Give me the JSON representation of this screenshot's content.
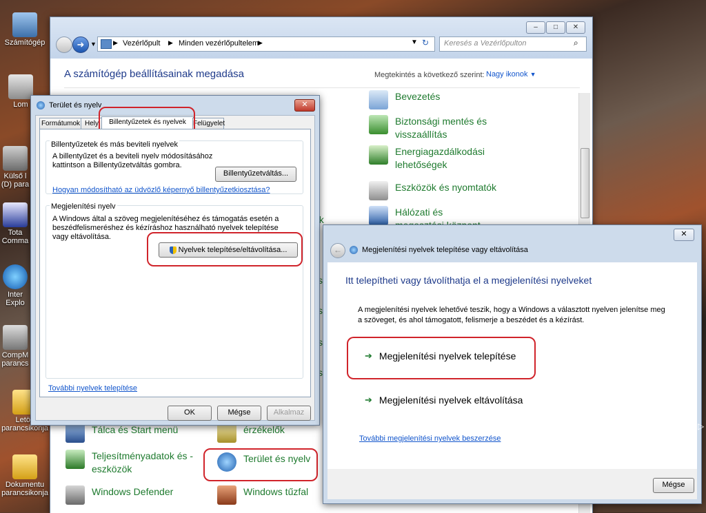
{
  "desktop": {
    "icons": [
      {
        "label": "Számítógép"
      },
      {
        "label": "Lom"
      },
      {
        "label": "Külső l (D) para"
      },
      {
        "label": "Tota Comma"
      },
      {
        "label": "Inter Explo"
      },
      {
        "label": "CompM parancs"
      },
      {
        "label": "Letölt parancsikonja"
      },
      {
        "label": "Dokumentu parancsikonja"
      }
    ]
  },
  "control_panel": {
    "address": {
      "breadcrumb1": "Vezérlőpult",
      "breadcrumb2": "Minden vezérlőpultelem",
      "search_placeholder": "Keresés a Vezérlőpulton"
    },
    "heading": "A számítógép beállításainak megadása",
    "view_label": "Megtekintés a következő szerint:",
    "view_value": "Nagy ikonok",
    "items_right": [
      {
        "label": "Bevezetés"
      },
      {
        "label": "Biztonsági mentés és visszaállítás"
      },
      {
        "label": "Energiagazdálkodási lehetőségek"
      },
      {
        "label": "Eszközök és nyomtatók"
      },
      {
        "label": "Hálózati és megosztási központ"
      }
    ],
    "items_bottom": [
      {
        "label": "Tálca és Start menü"
      },
      {
        "label": "érzékelők"
      },
      {
        "label": "Teljesítményadatok és -eszközök"
      },
      {
        "label": "Terület és nyelv"
      },
      {
        "label": "Windows Defender"
      },
      {
        "label": "Windows tűzfal"
      }
    ],
    "partial_left": [
      "ök",
      "s",
      "s",
      "s",
      "s"
    ]
  },
  "region_dialog": {
    "title": "Terület és nyelv",
    "tabs": [
      "Formátumok",
      "Hely",
      "Billentyűzetek és nyelvek",
      "Felügyelet"
    ],
    "kb_group_title": "Billentyűzetek és más beviteli nyelvek",
    "kb_group_text": "A billentyűzet és a beviteli nyelv módosításához kattintson a Billentyűzetváltás gombra.",
    "kb_button": "Billentyűzetváltás...",
    "kb_link": "Hogyan módosítható az üdvözlő képernyő billentyűzetkiosztása?",
    "display_group_title": "Megjelenítési nyelv",
    "display_group_text": "A Windows által a szöveg megjelenítéséhez és támogatás esetén a beszédfelismeréshez és kézíráshoz használható nyelvek telepítése vagy eltávolítása.",
    "install_button": "Nyelvek telepítése/eltávolítása...",
    "more_link": "További nyelvek telepítése",
    "ok": "OK",
    "cancel": "Mégse",
    "apply": "Alkalmaz"
  },
  "lang_dialog": {
    "title": "Megjelenítési nyelvek telepítése vagy eltávolítása",
    "heading": "Itt telepítheti vagy távolíthatja el a megjelenítési nyelveket",
    "description": "A megjelenítési nyelvek lehetővé teszik, hogy a Windows a választott nyelven jelenítse meg a szöveget, és ahol támogatott, felismerje a beszédet és a kézírást.",
    "option_install": "Megjelenítési nyelvek telepítése",
    "option_remove": "Megjelenítési nyelvek eltávolítása",
    "link": "További megjelenítési nyelvek beszerzése",
    "cancel": "Mégse"
  },
  "colors": {
    "accent_green": "#1e7a2e",
    "link_blue": "#1155cc",
    "highlight_red": "#d0232a"
  }
}
